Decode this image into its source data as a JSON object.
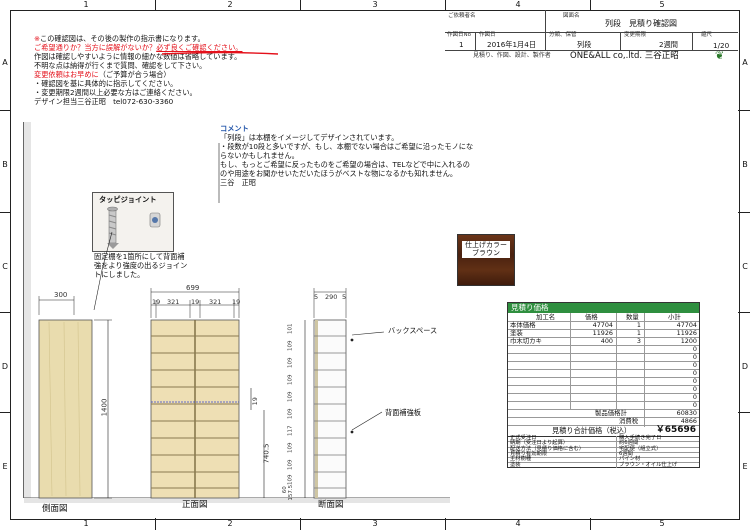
{
  "frame": {
    "columns": [
      "1",
      "2",
      "3",
      "4",
      "5"
    ],
    "rows": [
      "A",
      "B",
      "C",
      "D",
      "E"
    ]
  },
  "title_block": {
    "customer_label": "ご依頼者名",
    "drawing_name_label": "図面名",
    "drawing_name": "列段　見積り確認図",
    "drafter_label": "作図日No",
    "drafter_value": "1",
    "date_label": "作図日",
    "date_value": "2016年1月4日",
    "category_label": "分類、保管",
    "category_value": "列段",
    "revision_label": "変更期限",
    "revision_value": "2週間",
    "scale_label": "縮尺",
    "scale_value": "1/20",
    "company_desc": "見積り、作図、設計、製作者",
    "company_name": "ONE&ALL co,.ltd.  三谷正昭"
  },
  "notice": {
    "line1_mark": "※",
    "line1": "この確認図は、その後の製作の指示書になります。",
    "line2a": "ご希望通りか？当方に誤解がないか？",
    "line2b": "必ず良くご確認ください。",
    "line3": "作図は確認しやすいように情報の細かな数値は省略しています。",
    "line4": "不明な点は納得が行くまで質問、確認をして下さい。",
    "line5a": "変更依頼はお早めに",
    "line5b": "（ご予算が合う場合）",
    "line6": "・確認図を基に具体的に指示してください。",
    "line7": "・変更期限2週間以上必要な方はご連絡ください。",
    "line8": "デザイン担当三谷正昭　tel072-630-3360"
  },
  "comment": {
    "title": "コメント",
    "lines": [
      "「列段」は本棚をイメージしてデザインされています。",
      "・段数が10段と多いですが、もし、本棚でない場合はご希望に沿ったモノにな",
      "らないかもしれません。",
      "もし、もっとご希望に反ったものをご希望の場合は、TELなどで中に入れるの",
      "のや用途をお聞かせいただいたほうがベストな物になるかも知れません。",
      "三谷　正昭"
    ]
  },
  "joint": {
    "label": "タッピジョイント",
    "desc": [
      "固定棚を1箇所にして背面補",
      "強をより強度の出るジョイン",
      "トにしました。"
    ]
  },
  "color_sample": {
    "label": "仕上げカラー\nブラウン",
    "color": "#5a2a12"
  },
  "views": {
    "side_label": "側面図",
    "front_label": "正面図",
    "section_label": "断面図",
    "side_width": "300",
    "side_height": "1400",
    "front_total": "699",
    "front_parts": [
      "19",
      "321",
      "19",
      "321",
      "19"
    ],
    "front_mid": "19",
    "front_low": "740.5",
    "section_parts": [
      "5",
      "290",
      "5"
    ],
    "section_heights": [
      "101",
      "109",
      "109",
      "109",
      "109",
      "109",
      "117",
      "109",
      "109",
      "109",
      "157.5"
    ],
    "section_bottom": "60",
    "back_space": "バックスペース",
    "back_panel": "背面補強板"
  },
  "estimate": {
    "header": "見積り価格",
    "col_item": "加工名",
    "col_price": "価格",
    "col_qty": "数量",
    "col_sub": "小計",
    "items": [
      {
        "name": "本体価格",
        "price": "47704",
        "qty": "1",
        "sub": "47704"
      },
      {
        "name": "塗装",
        "price": "11926",
        "qty": "1",
        "sub": "11926"
      },
      {
        "name": "巾木切カキ",
        "price": "400",
        "qty": "3",
        "sub": "1200"
      }
    ],
    "blank_subs": [
      "0",
      "0",
      "0",
      "0",
      "0",
      "0",
      "0",
      "0"
    ],
    "product_label": "製品価格計",
    "product_value": "60830",
    "tax_label": "消費税",
    "tax_value": "4866",
    "total_label": "見積り合計価格（税込）",
    "total_value": "￥65696",
    "details": [
      {
        "k": "正式受注日",
        "v": "購入手続き完了日"
      },
      {
        "k": "納期（受注日より起算）",
        "v": "約6週間"
      },
      {
        "k": "配送方法（見積り価格に含む）",
        "v": "宅配便（組立式）"
      },
      {
        "k": "見積り有効期限",
        "v": "6週間"
      },
      {
        "k": "主材樹種",
        "v": "パイン材"
      },
      {
        "k": "塗装",
        "v": "ブラウン・オイル仕上げ"
      }
    ],
    "accent": "#2f8f3f"
  }
}
